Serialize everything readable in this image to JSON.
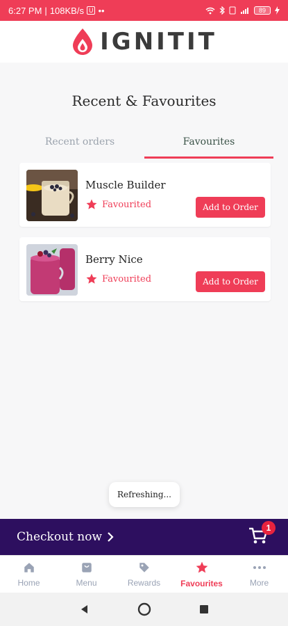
{
  "status_bar": {
    "time": "6:27 PM",
    "speed": "108KB/s",
    "mini_badge": "U",
    "dots": "••",
    "battery": "89"
  },
  "brand": {
    "name": "IGNITIT",
    "accent_color": "#ef3d57",
    "dark_color": "#2d0f5f"
  },
  "page": {
    "title": "Recent & Favourites"
  },
  "tabs": [
    {
      "label": "Recent orders",
      "active": false
    },
    {
      "label": "Favourites",
      "active": true
    }
  ],
  "favourites": [
    {
      "name": "Muscle Builder",
      "status": "Favourited",
      "button": "Add to Order",
      "image_icon": "vanilla-smoothie-photo"
    },
    {
      "name": "Berry Nice",
      "status": "Favourited",
      "button": "Add to Order",
      "image_icon": "berry-smoothie-photo"
    }
  ],
  "toast": {
    "text": "Refreshing..."
  },
  "checkout": {
    "label": "Checkout now",
    "cart_count": "1"
  },
  "bottom_nav": [
    {
      "label": "Home",
      "icon": "home-icon",
      "active": false
    },
    {
      "label": "Menu",
      "icon": "menu-bag-icon",
      "active": false
    },
    {
      "label": "Rewards",
      "icon": "tag-icon",
      "active": false
    },
    {
      "label": "Favourites",
      "icon": "star-icon",
      "active": true
    },
    {
      "label": "More",
      "icon": "more-dots-icon",
      "active": false
    }
  ],
  "system_nav": [
    "back-icon",
    "home-circle-icon",
    "recents-icon"
  ]
}
